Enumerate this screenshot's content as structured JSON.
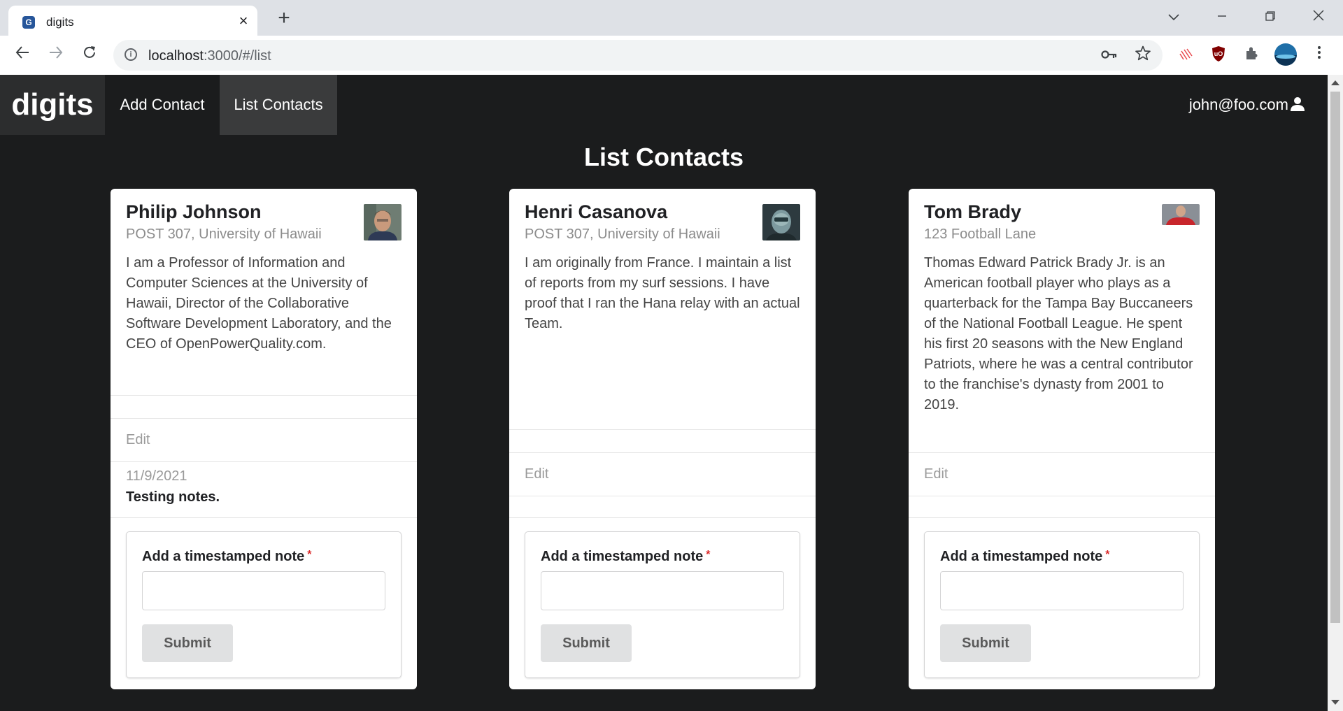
{
  "browser": {
    "tab_title": "digits",
    "favicon_text": "G",
    "url_host": "localhost",
    "url_rest": ":3000/#/list"
  },
  "nav": {
    "brand": "digits",
    "items": [
      {
        "label": "Add Contact",
        "active": false
      },
      {
        "label": "List Contacts",
        "active": true
      }
    ],
    "user": "john@foo.com"
  },
  "page": {
    "title": "List Contacts"
  },
  "form": {
    "label": "Add a timestamped note",
    "required_mark": "*",
    "submit_label": "Submit"
  },
  "contacts": [
    {
      "name": "Philip Johnson",
      "address": "POST 307, University of Hawaii",
      "description": "I am a Professor of Information and Computer Sciences at the University of Hawaii, Director of the Collaborative Software Development Laboratory, and the CEO of OpenPowerQuality.com.",
      "edit_label": "Edit",
      "notes": [
        {
          "date": "11/9/2021",
          "text": "Testing notes."
        }
      ]
    },
    {
      "name": "Henri Casanova",
      "address": "POST 307, University of Hawaii",
      "description": "I am originally from France. I maintain a list of reports from my surf sessions. I have proof that I ran the Hana relay with an actual Team.",
      "edit_label": "Edit",
      "notes": []
    },
    {
      "name": "Tom Brady",
      "address": "123 Football Lane",
      "description": "Thomas Edward Patrick Brady Jr. is an American football player who plays as a quarterback for the Tampa Bay Buccaneers of the National Football League. He spent his first 20 seasons with the New England Patriots, where he was a central contributor to the franchise's dynasty from 2001 to 2019.",
      "edit_label": "Edit",
      "notes": []
    }
  ]
}
